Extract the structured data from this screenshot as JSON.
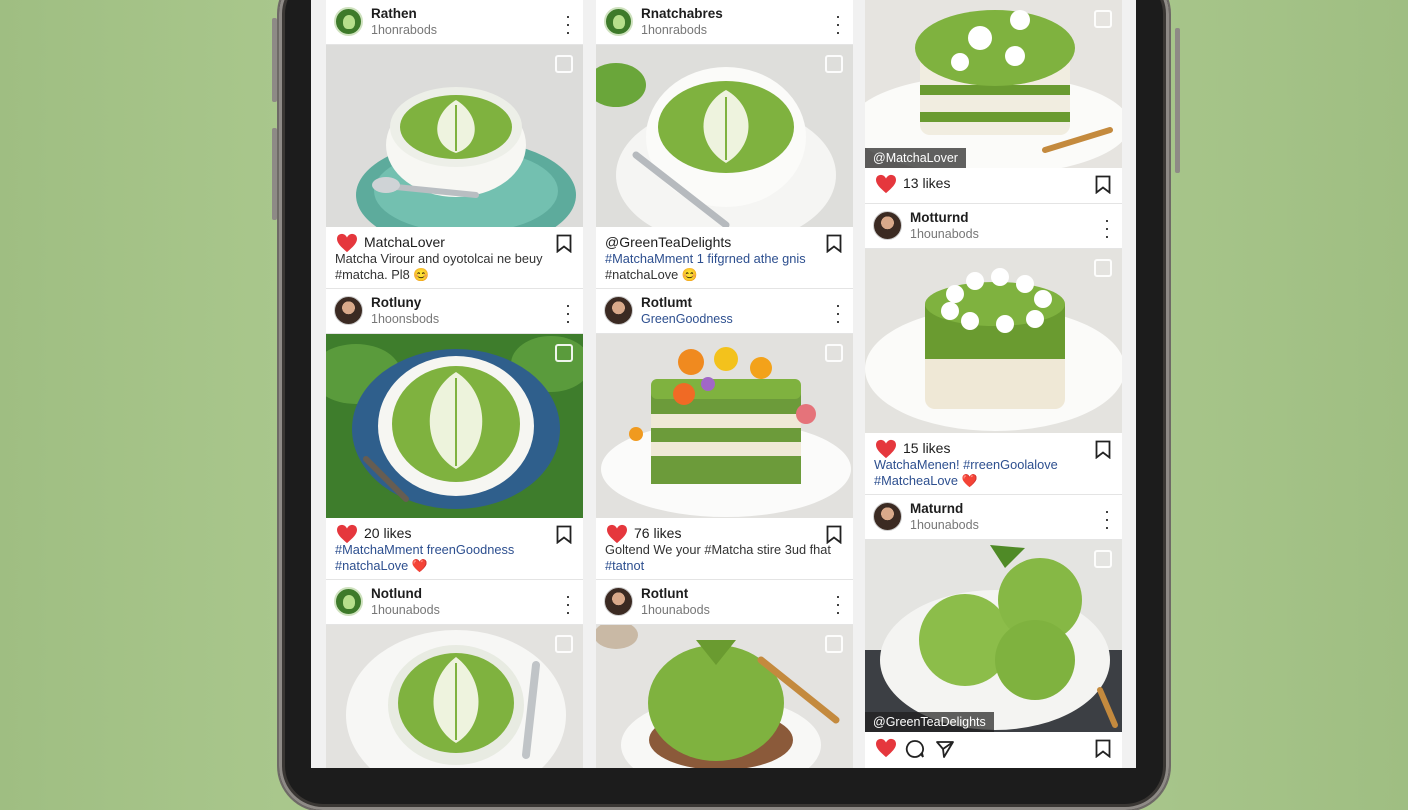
{
  "colors": {
    "accent": "#e5373d",
    "matcha": "#7fae3e",
    "link": "#2d4f8f"
  },
  "col1": {
    "post1": {
      "user": "Rathen",
      "sub": "1honrabods",
      "author": "MatchaLover",
      "line1": "Matcha Virour and oyotolcai ne beuy",
      "line2": "#matcha. Pl8 😊"
    },
    "post2": {
      "user": "Rotluny",
      "sub": "1hoonsbods",
      "likes": "20 likes",
      "line1": "#MatchaMment freenGoodness",
      "line2": "#natchaLove ❤️"
    },
    "post3": {
      "user": "Notlund",
      "sub": "1hounabods"
    }
  },
  "col2": {
    "post1": {
      "user": "Rnatchabres",
      "sub": "1honrabods",
      "author": "@GreenTeaDelights",
      "line1": "#MatchaMment 1 fifgrned athe gnis",
      "line2": "#natchaLove 😊"
    },
    "post2": {
      "user": "Rotlumt",
      "sub": "GreenGoodness",
      "likes": "76 likes",
      "line1": "Goltend We your #Matcha stire 3ud fhat",
      "line2": "#tatnot"
    },
    "post3": {
      "user": "Rotlunt",
      "sub": "1hounabods"
    }
  },
  "col3": {
    "post1": {
      "watermark": "@MatchaLover",
      "likes": "13 likes"
    },
    "post2": {
      "user": "Motturnd",
      "sub": "1hounabods",
      "likes": "15 likes",
      "line1": "WatchaMenen! #rreenGoolalove",
      "line2": "#MatcheaLove ❤️"
    },
    "post3": {
      "user": "Maturnd",
      "sub": "1hounabods",
      "watermark": "@GreenTeaDelights"
    }
  }
}
